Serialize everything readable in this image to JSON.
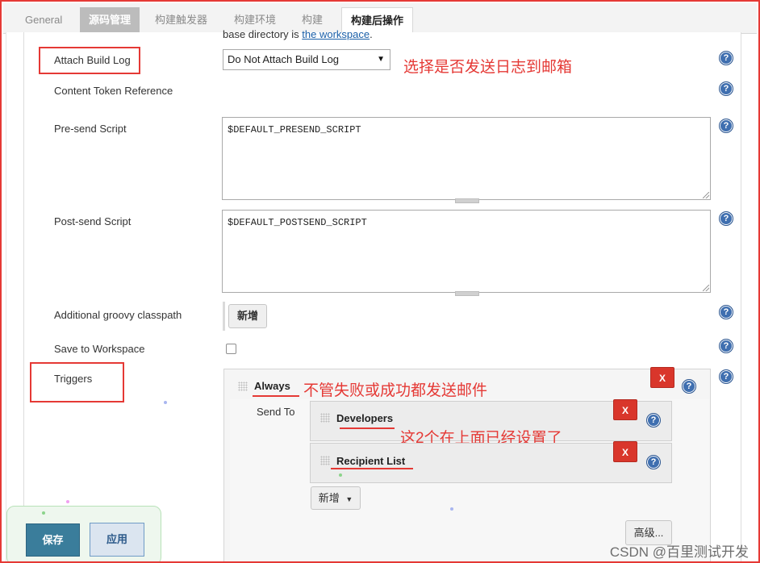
{
  "tabs": [
    {
      "label": "General",
      "state": "normal"
    },
    {
      "label": "源码管理",
      "state": "dark"
    },
    {
      "label": "构建触发器",
      "state": "normal"
    },
    {
      "label": "构建环境",
      "state": "normal"
    },
    {
      "label": "构建",
      "state": "normal"
    },
    {
      "label": "构建后操作",
      "state": "active"
    }
  ],
  "top_note": {
    "prefix": "base directory is ",
    "link": "the workspace",
    "suffix": "."
  },
  "fields": {
    "attach_build_log": {
      "label": "Attach Build Log",
      "value": "Do Not Attach Build Log"
    },
    "content_token": {
      "label": "Content Token Reference"
    },
    "pre_send": {
      "label": "Pre-send Script",
      "value": "$DEFAULT_PRESEND_SCRIPT"
    },
    "post_send": {
      "label": "Post-send Script",
      "value": "$DEFAULT_POSTSEND_SCRIPT"
    },
    "groovy": {
      "label": "Additional groovy classpath",
      "button": "新增"
    },
    "save_ws": {
      "label": "Save to Workspace"
    },
    "triggers": {
      "label": "Triggers"
    }
  },
  "trigger": {
    "name": "Always",
    "send_to_label": "Send To",
    "recipients": [
      "Developers",
      "Recipient List"
    ],
    "add_label": "新增",
    "advanced_label": "高级...",
    "delete_label": "X"
  },
  "annotations": {
    "attach_note": "选择是否发送日志到邮箱",
    "always_note": "不管失败或成功都发送邮件",
    "recipients_note": "这2个在上面已经设置了"
  },
  "help_glyph": "?",
  "actions": {
    "save": "保存",
    "apply": "应用"
  },
  "watermark": "CSDN @百里测试开发",
  "colors": {
    "annotation_red": "#e53935",
    "help_blue": "#3f6fb0",
    "save_blue": "#3a7d9b",
    "delete_red": "#d9362b"
  }
}
